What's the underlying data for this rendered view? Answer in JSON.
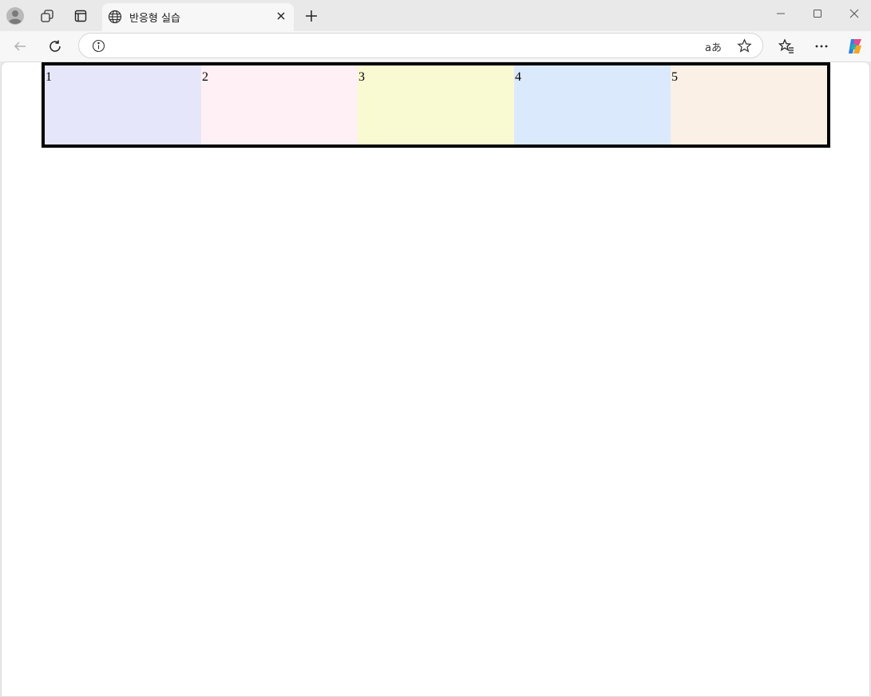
{
  "browser": {
    "tab_title": "반응형 실습",
    "address_text": "",
    "translate_label": "aあ"
  },
  "icons": {
    "profile": "profile-icon",
    "workspaces": "workspaces-icon",
    "tab_actions": "tab-actions-icon",
    "globe": "globe-icon",
    "close_tab": "close-icon",
    "new_tab": "plus-icon",
    "minimize": "minimize-icon",
    "maximize": "maximize-icon",
    "close_window": "close-icon",
    "back": "back-arrow-icon",
    "refresh": "refresh-icon",
    "info": "info-icon",
    "favorite": "star-icon",
    "favorites": "favorites-icon",
    "more": "more-icon",
    "copilot": "copilot-icon"
  },
  "page": {
    "boxes": [
      {
        "label": "1",
        "color": "#e6e6fa"
      },
      {
        "label": "2",
        "color": "#fff0f5"
      },
      {
        "label": "3",
        "color": "#f9f9d2"
      },
      {
        "label": "4",
        "color": "#dbe9fd"
      },
      {
        "label": "5",
        "color": "#faf0e6"
      }
    ],
    "border_color": "#000000"
  }
}
